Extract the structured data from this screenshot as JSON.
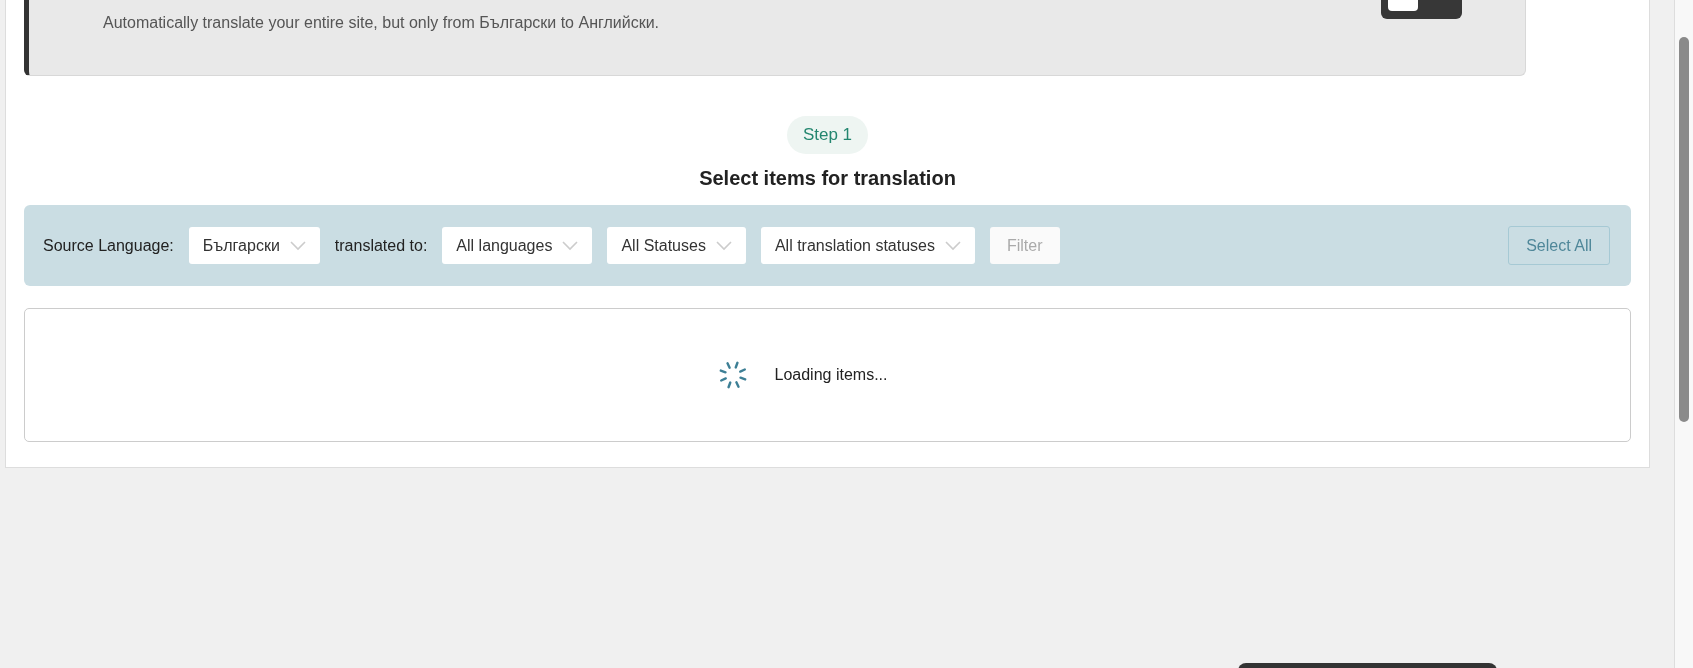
{
  "auto_translate_card": {
    "toggle": {
      "on": false
    },
    "description": "Automatically translate your entire site, but only from Български to Английски."
  },
  "step": {
    "badge": "Step 1",
    "heading": "Select items for translation"
  },
  "filter_bar": {
    "source_label": "Source Language:",
    "source_value": "Български",
    "target_label": "translated to:",
    "dropdowns": [
      {
        "value": "All languages"
      },
      {
        "value": "All Statuses"
      },
      {
        "value": "All translation statuses"
      }
    ],
    "filter_button": {
      "label": "Filter",
      "disabled": true
    },
    "select_all_button": {
      "label": "Select All",
      "disabled": true
    }
  },
  "items_panel": {
    "loading_text": "Loading items..."
  }
}
